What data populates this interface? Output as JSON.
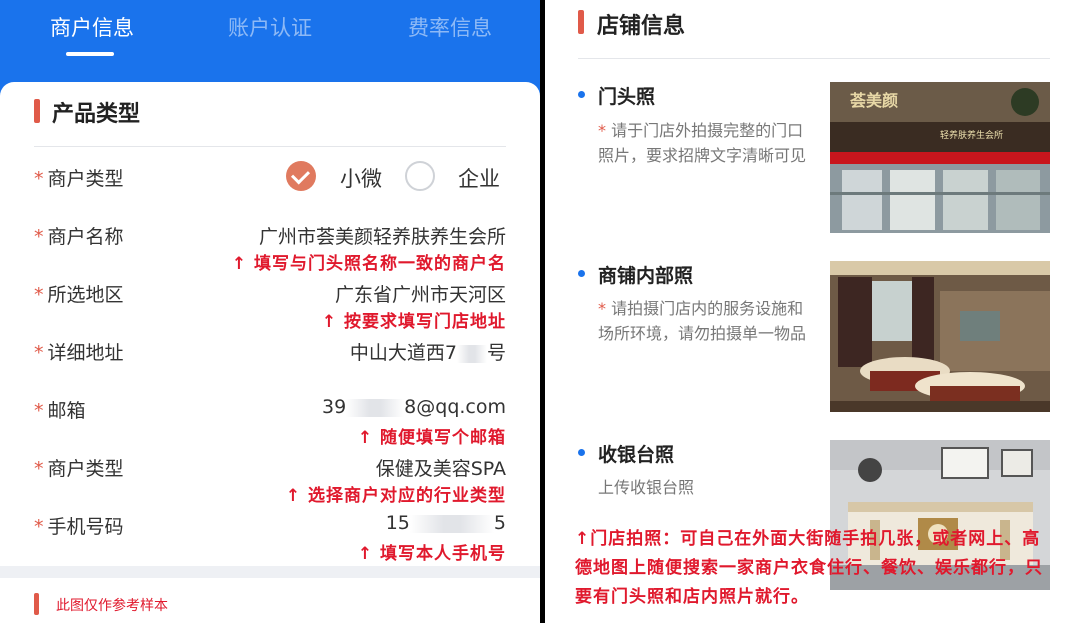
{
  "tabs": [
    "商户信息",
    "账户认证",
    "费率信息"
  ],
  "product_section": {
    "title": "产品类型"
  },
  "required_mark": "*",
  "arrow": "↑",
  "fields": {
    "merchant_type": {
      "label": "商户类型",
      "option_selected": "小微",
      "option_other": "企业"
    },
    "merchant_name": {
      "label": "商户名称",
      "value": "广州市荟美颜轻养肤养生会所",
      "hint": "填写与门头照名称一致的商户名"
    },
    "region": {
      "label": "所选地区",
      "value": "广东省广州市天河区",
      "hint": "按要求填写门店地址"
    },
    "address": {
      "label": "详细地址",
      "value_start": "中山大道西7",
      "value_end": "号"
    },
    "email": {
      "label": "邮箱",
      "value_start": "39",
      "value_end": "8@qq.com",
      "hint": "随便填写个邮箱"
    },
    "industry": {
      "label": "商户类型",
      "value": "保健及美容SPA",
      "hint": "选择商户对应的行业类型"
    },
    "phone": {
      "label": "手机号码",
      "value_start": "15",
      "value_end": "5",
      "hint": "填写本人手机号"
    }
  },
  "footer_note": "此图仅作参考样本",
  "store_section": {
    "title": "店铺信息",
    "items": [
      {
        "title": "门头照",
        "desc": "请于门店外拍摄完整的门口照片，要求招牌文字清晰可见",
        "required": true,
        "sign_text": "荟美颜",
        "sign_sub": "轻养肤养生会所"
      },
      {
        "title": "商铺内部照",
        "desc": "请拍摄门店内的服务设施和场所环境，请勿拍摄单一物品",
        "required": true
      },
      {
        "title": "收银台照",
        "desc": "上传收银台照",
        "required": false
      }
    ]
  },
  "annotation": "门店拍照：可自己在外面大街随手拍几张，或者网上、高德地图上随便搜索一家商户衣食住行、餐饮、娱乐都行，只要有门头照和店内照片就行。",
  "colors": {
    "brand_blue": "#1a73ec",
    "accent_red": "#e0192d",
    "section_bar": "#e05a49",
    "radio_checked": "#e07a5f"
  }
}
